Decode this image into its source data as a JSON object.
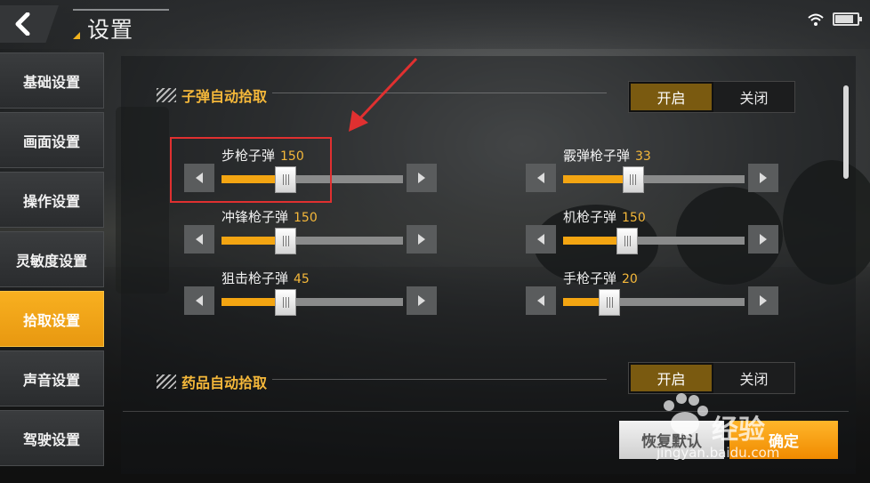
{
  "header": {
    "title": "设置"
  },
  "sidebar": {
    "items": [
      {
        "label": "基础设置",
        "active": false
      },
      {
        "label": "画面设置",
        "active": false
      },
      {
        "label": "操作设置",
        "active": false
      },
      {
        "label": "灵敏度设置",
        "active": false
      },
      {
        "label": "拾取设置",
        "active": true
      },
      {
        "label": "声音设置",
        "active": false
      },
      {
        "label": "驾驶设置",
        "active": false
      }
    ]
  },
  "ammo_section": {
    "title": "子弹自动拾取",
    "toggle": {
      "on_label": "开启",
      "off_label": "关闭",
      "selected": "开启"
    }
  },
  "sliders": [
    {
      "label": "步枪子弹",
      "value": "150",
      "fill_fraction": 0.35
    },
    {
      "label": "霰弹枪子弹",
      "value": "33",
      "fill_fraction": 0.38
    },
    {
      "label": "冲锋枪子弹",
      "value": "150",
      "fill_fraction": 0.35
    },
    {
      "label": "机枪子弹",
      "value": "150",
      "fill_fraction": 0.35
    },
    {
      "label": "狙击枪子弹",
      "value": "45",
      "fill_fraction": 0.35
    },
    {
      "label": "手枪子弹",
      "value": "20",
      "fill_fraction": 0.25
    }
  ],
  "medicine_section": {
    "title": "药品自动拾取",
    "toggle": {
      "on_label": "开启",
      "off_label": "关闭",
      "selected": "开启"
    }
  },
  "footer": {
    "reset_label": "恢复默认",
    "confirm_label": "确定"
  },
  "watermark": {
    "brand": "经验",
    "url": "jingyan.baidu.com"
  },
  "colors": {
    "accent": "#f3a512",
    "highlight": "#e03030"
  },
  "icons": [
    "back-arrow-icon",
    "wifi-icon",
    "battery-icon",
    "left-arrow-icon",
    "right-arrow-icon",
    "stripe-icon",
    "paw-icon"
  ]
}
